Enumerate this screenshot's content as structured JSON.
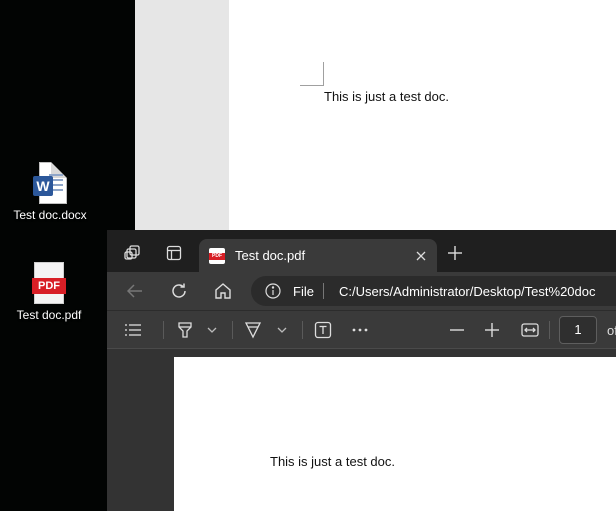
{
  "desktop": {
    "icons": [
      {
        "label": "Test doc.docx",
        "badge": "W",
        "icon": "word-file-icon"
      },
      {
        "label": "Test doc.pdf",
        "badge": "PDF",
        "icon": "pdf-file-icon"
      }
    ]
  },
  "word": {
    "document_text": "This is just a test doc."
  },
  "browser": {
    "tab": {
      "title": "Test doc.pdf",
      "favicon_text": "PDF"
    },
    "address": {
      "scheme": "File",
      "url": "C:/Users/Administrator/Desktop/Test%20doc"
    },
    "pdf_toolbar": {
      "page_number": "1",
      "page_of": "of"
    },
    "document_text": "This is just a test doc."
  },
  "colors": {
    "edge_dark": "#202020",
    "edge_toolbar": "#3a3a3a",
    "word_blue": "#2b579a",
    "pdf_red": "#d81f26"
  }
}
